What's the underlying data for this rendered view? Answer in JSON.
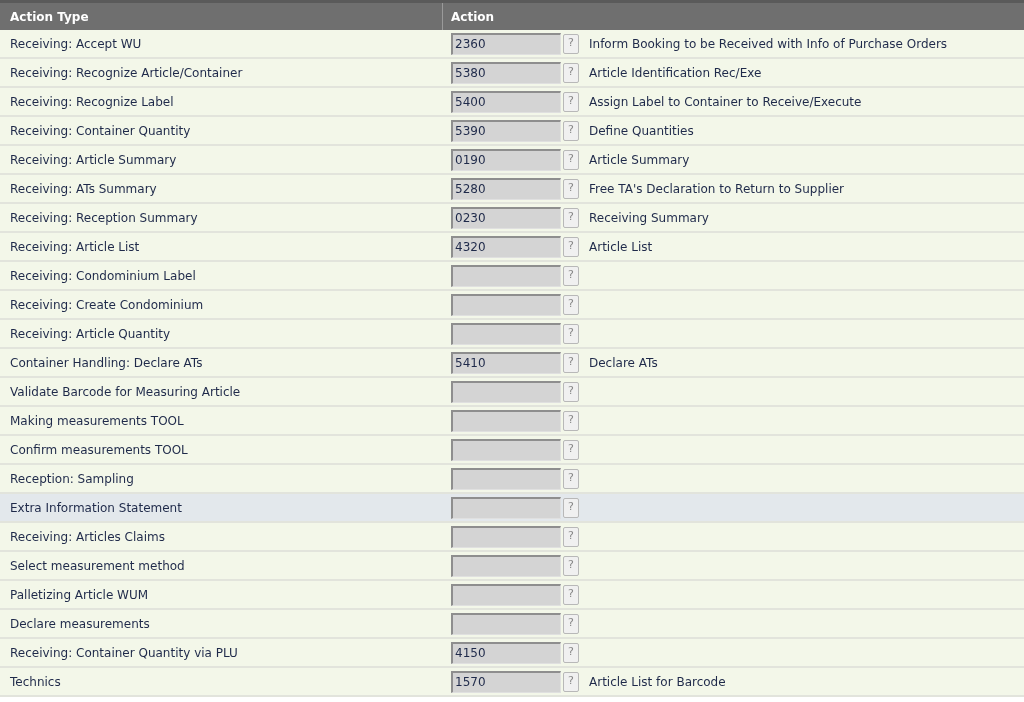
{
  "columns": [
    "Action Type",
    "Action"
  ],
  "rows": [
    {
      "type": "Receiving: Accept WU",
      "code": "2360",
      "description": "Inform Booking to be Received with Info of Purchase Orders",
      "selected": false
    },
    {
      "type": "Receiving: Recognize Article/Container",
      "code": "5380",
      "description": "Article Identification Rec/Exe",
      "selected": false
    },
    {
      "type": "Receiving: Recognize Label",
      "code": "5400",
      "description": "Assign Label to Container to Receive/Execute",
      "selected": false
    },
    {
      "type": "Receiving: Container Quantity",
      "code": "5390",
      "description": "Define Quantities",
      "selected": false
    },
    {
      "type": "Receiving: Article Summary",
      "code": "0190",
      "description": "Article Summary",
      "selected": false
    },
    {
      "type": "Receiving: ATs Summary",
      "code": "5280",
      "description": "Free TA's Declaration to Return to Supplier",
      "selected": false
    },
    {
      "type": "Receiving: Reception Summary",
      "code": "0230",
      "description": "Receiving Summary",
      "selected": false
    },
    {
      "type": "Receiving: Article List",
      "code": "4320",
      "description": "Article List",
      "selected": false
    },
    {
      "type": "Receiving: Condominium Label",
      "selected": false
    },
    {
      "type": "Receiving: Create Condominium",
      "selected": false
    },
    {
      "type": "Receiving: Article Quantity",
      "selected": false
    },
    {
      "type": "Container Handling: Declare ATs",
      "code": "5410",
      "description": "Declare ATs",
      "selected": false
    },
    {
      "type": "Validate Barcode for Measuring Article",
      "selected": false
    },
    {
      "type": "Making measurements TOOL",
      "selected": false
    },
    {
      "type": "Confirm measurements TOOL",
      "selected": false
    },
    {
      "type": "Reception: Sampling",
      "selected": false
    },
    {
      "type": "Extra Information Statement",
      "selected": true
    },
    {
      "type": "Receiving: Articles Claims",
      "selected": false
    },
    {
      "type": "Select measurement method",
      "selected": false
    },
    {
      "type": "Palletizing Article WUM",
      "selected": false
    },
    {
      "type": "Declare measurements",
      "selected": false
    },
    {
      "type": "Receiving: Container Quantity via PLU",
      "code": "4150",
      "selected": false
    },
    {
      "type": "Technics",
      "code": "1570",
      "description": "Article List for Barcode",
      "selected": false
    }
  ],
  "help_label": "?"
}
